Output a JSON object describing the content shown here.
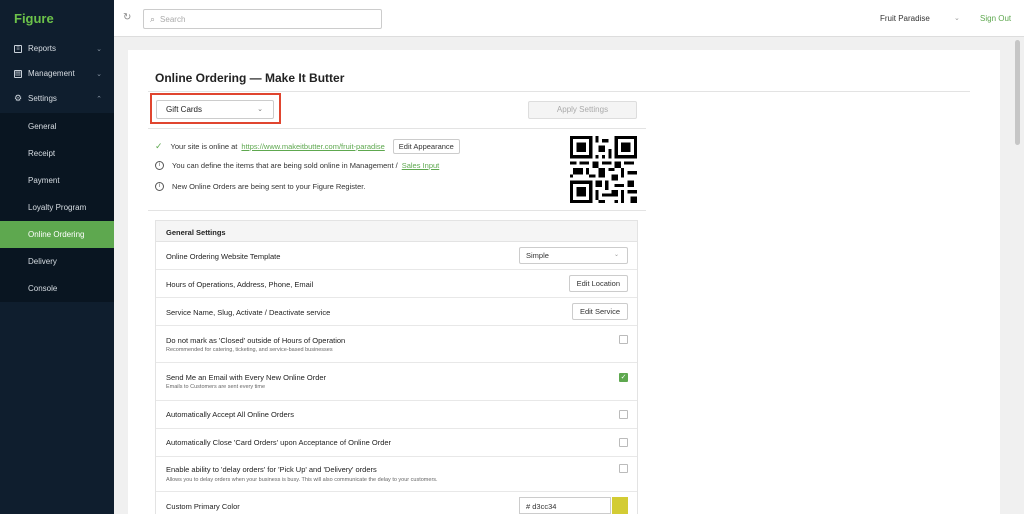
{
  "brand": "Figure",
  "sidebar": {
    "items": [
      {
        "label": "Reports",
        "icon": "report-icon"
      },
      {
        "label": "Management",
        "icon": "management-icon"
      },
      {
        "label": "Settings",
        "icon": "gear-icon"
      }
    ],
    "sub_items": [
      "General",
      "Receipt",
      "Payment",
      "Loyalty Program",
      "Online Ordering",
      "Delivery",
      "Console"
    ],
    "active": "Online Ordering"
  },
  "topbar": {
    "search_placeholder": "Search",
    "store": "Fruit Paradise",
    "signout": "Sign Out"
  },
  "main": {
    "title": "Online Ordering — Make It Butter",
    "selected_option": "Gift Cards",
    "apply_label": "Apply Settings",
    "site_online_text": "Your site is online at",
    "site_url": "https://www.makeitbutter.com/fruit-paradise",
    "edit_appearance": "Edit Appearance",
    "define_items_text": "You can define the items that are being sold online in Management /",
    "sales_input_link": "Sales Input",
    "orders_sent_text": "New Online Orders are being sent to your Figure Register."
  },
  "settings": {
    "header": "General Settings",
    "template_label": "Online Ordering Website Template",
    "template_value": "Simple",
    "hours_label": "Hours of Operations, Address, Phone, Email",
    "hours_button": "Edit Location",
    "service_label": "Service Name, Slug, Activate / Deactivate service",
    "service_button": "Edit Service",
    "closed_label": "Do not mark as 'Closed' outside of Hours of Operation",
    "closed_sub": "Recommended for catering, ticketing, and service-based businesses",
    "email_label": "Send Me an Email with Every New Online Order",
    "email_sub": "Emails to Customers are sent every time",
    "auto_accept_label": "Automatically Accept All Online Orders",
    "auto_close_label": "Automatically Close 'Card Orders' upon Acceptance of Online Order",
    "delay_label": "Enable ability to 'delay orders' for 'Pick Up' and 'Delivery' orders",
    "delay_sub": "Allows you to delay orders when your business is busy. This will also communicate the delay to your customers.",
    "color_label": "Custom Primary Color",
    "color_value": "#  d3cc34",
    "color_hex": "#d3cc34"
  },
  "colors": {
    "accent": "#5ea84f",
    "sidebar_bg": "#0f1e2e",
    "highlight": "#e0452f"
  }
}
